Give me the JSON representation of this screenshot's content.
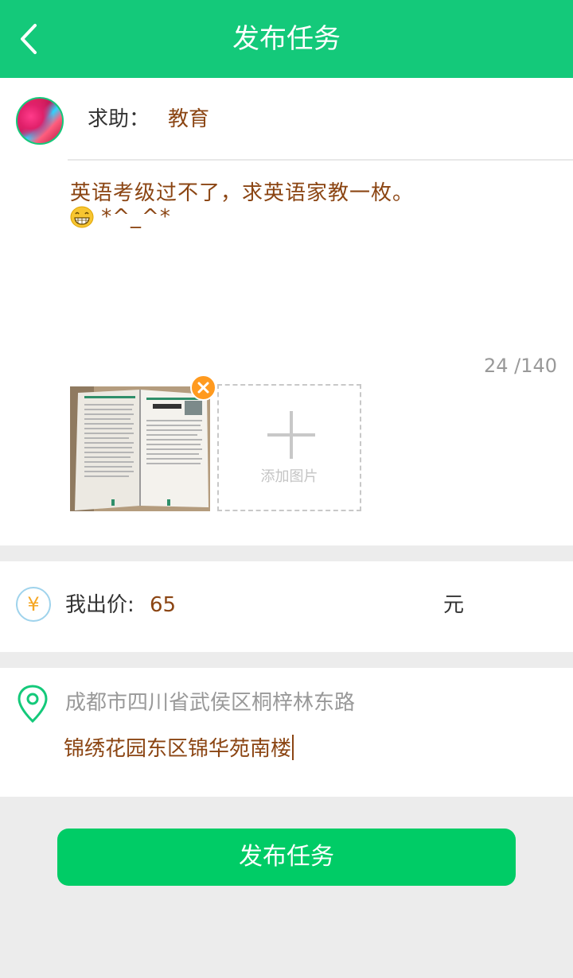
{
  "header": {
    "title": "发布任务",
    "back_icon": "chevron-left-icon"
  },
  "request": {
    "label": "求助：",
    "category": "教育",
    "description": "英语考级过不了，求英语家教一枚。",
    "description_suffix": "*^_^*",
    "emoji_icon": "grinning-face-icon",
    "counter": "24 /140"
  },
  "images": {
    "add_label": "添加图片",
    "remove_icon": "close-icon",
    "add_icon": "plus-icon"
  },
  "price": {
    "label": "我出价:",
    "value": "65",
    "unit": "元",
    "icon": "yen-icon"
  },
  "location": {
    "city": "成都市四川省武侯区桐梓林东路",
    "detail": "锦绣花园东区锦华苑南楼",
    "icon": "location-pin-icon"
  },
  "submit": {
    "label": "发布任务"
  },
  "colors": {
    "primary": "#14c97a",
    "button": "#00cc66",
    "accent_text": "#8b4513",
    "badge": "#ff9a1f"
  }
}
